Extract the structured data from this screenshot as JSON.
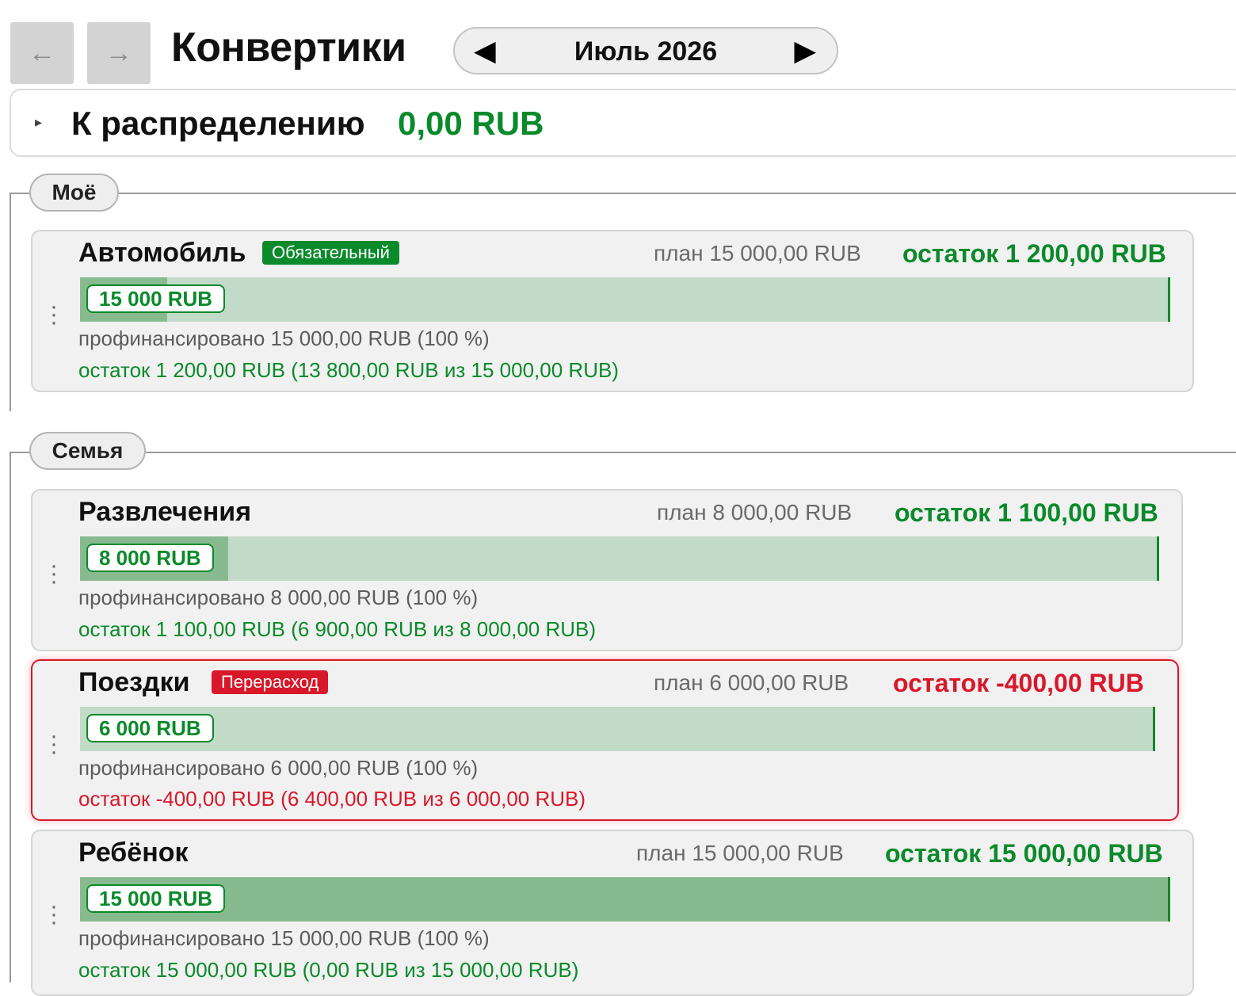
{
  "header": {
    "back_icon": "←",
    "forward_icon": "→",
    "title": "Конвертики",
    "month": {
      "prev_icon": "◀",
      "label": "Июль 2026",
      "next_icon": "▶"
    }
  },
  "distribute": {
    "caret_icon": "▸",
    "label": "К распределению",
    "amount": "0,00 RUB"
  },
  "colors": {
    "positive": "#0a8a2a",
    "negative": "#d8182a",
    "bar_track": "#c2dbc8",
    "bar_fill": "#87bb8f"
  },
  "groups": [
    {
      "name": "Моё",
      "envelopes": [
        {
          "name": "Автомобиль",
          "badge": "Обязательный",
          "badge_color": "green",
          "plan": "план 15 000,00 RUB",
          "rest": "остаток 1 200,00 RUB",
          "rest_color": "green",
          "chip": "15 000 RUB",
          "spent_fraction": 0.08,
          "funded": "профинансировано 15 000,00 RUB (100 %)",
          "remain": "остаток 1 200,00 RUB (13 800,00 RUB из 15 000,00 RUB)"
        }
      ]
    },
    {
      "name": "Семья",
      "envelopes": [
        {
          "name": "Развлечения",
          "plan": "план 8 000,00 RUB",
          "rest": "остаток 1 100,00 RUB",
          "rest_color": "green",
          "chip": "8 000 RUB",
          "spent_fraction": 0.1375,
          "funded": "профинансировано 8 000,00 RUB (100 %)",
          "remain": "остаток 1 100,00 RUB (6 900,00 RUB из 8 000,00 RUB)"
        },
        {
          "name": "Поездки",
          "badge": "Перерасход",
          "badge_color": "red",
          "plan": "план 6 000,00 RUB",
          "rest": "остаток -400,00 RUB",
          "rest_color": "red",
          "chip": "6 000 RUB",
          "spent_fraction": 0,
          "funded": "профинансировано 6 000,00 RUB (100 %)",
          "remain": "остаток -400,00 RUB (6 400,00 RUB из 6 000,00 RUB)"
        },
        {
          "name": "Ребёнок",
          "plan": "план 15 000,00 RUB",
          "rest": "остаток 15 000,00 RUB",
          "rest_color": "green",
          "chip": "15 000 RUB",
          "spent_fraction": 1,
          "funded": "профинансировано 15 000,00 RUB (100 %)",
          "remain": "остаток 15 000,00 RUB (0,00 RUB из 15 000,00 RUB)"
        }
      ]
    }
  ]
}
